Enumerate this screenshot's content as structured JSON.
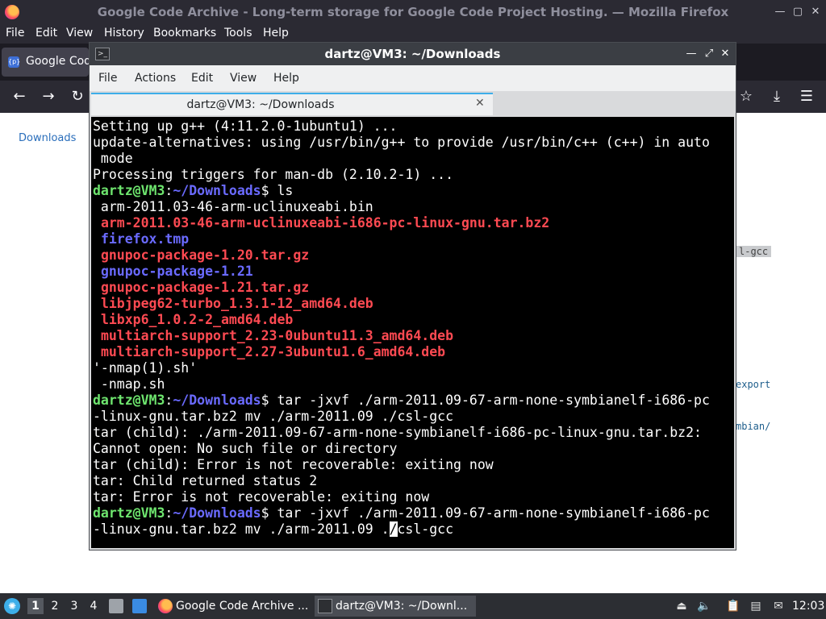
{
  "firefox": {
    "window_title": "Google Code Archive - Long-term storage for Google Code Project Hosting. — Mozilla Firefox",
    "menus": [
      "File",
      "Edit",
      "View",
      "History",
      "Bookmarks",
      "Tools",
      "Help"
    ],
    "tab_label": "Google Code Archive - Long-term storage for Google Code Project Hosting.",
    "tab_favicon_text": "{p}",
    "content": {
      "downloads_link": "Downloads",
      "snippets": [
        "l-gcc",
        "export",
        "mbian/"
      ]
    },
    "icons": [
      "firefox-logo-icon",
      "back-icon",
      "forward-icon",
      "reload-icon",
      "bookmark-star-icon",
      "downloads-icon",
      "menu-icon"
    ]
  },
  "terminal": {
    "window_title": "dartz@VM3: ~/Downloads",
    "menus": [
      "File",
      "Actions",
      "Edit",
      "View",
      "Help"
    ],
    "tab_label": "dartz@VM3: ~/Downloads",
    "colors": {
      "prompt_user": "#6ee56e",
      "prompt_path": "#6a6aff",
      "archive": "#ff4a52",
      "directory": "#6a6aff",
      "background": "#000000",
      "text": "#ffffff"
    },
    "lines": [
      [
        {
          "t": "Setting up g++ (4:11.2.0-1ubuntu1) ...",
          "c": "plain"
        }
      ],
      [
        {
          "t": "update-alternatives: using /usr/bin/g++ to provide /usr/bin/c++ (c++) in auto",
          "c": "plain"
        }
      ],
      [
        {
          "t": " mode",
          "c": "plain"
        }
      ],
      [
        {
          "t": "Processing triggers for man-db (2.10.2-1) ...",
          "c": "plain"
        }
      ],
      [
        {
          "t": "dartz@VM3",
          "c": "green"
        },
        {
          "t": ":",
          "c": "white"
        },
        {
          "t": "~/Downloads",
          "c": "blue"
        },
        {
          "t": "$ ls",
          "c": "white"
        }
      ],
      [
        {
          "t": " arm-2011.03-46-arm-uclinuxeabi.bin",
          "c": "plain"
        }
      ],
      [
        {
          "t": " ",
          "c": "plain"
        },
        {
          "t": "arm-2011.03-46-arm-uclinuxeabi-i686-pc-linux-gnu.tar.bz2",
          "c": "red"
        }
      ],
      [
        {
          "t": " ",
          "c": "plain"
        },
        {
          "t": "firefox.tmp",
          "c": "blue"
        }
      ],
      [
        {
          "t": " ",
          "c": "plain"
        },
        {
          "t": "gnupoc-package-1.20.tar.gz",
          "c": "red"
        }
      ],
      [
        {
          "t": " ",
          "c": "plain"
        },
        {
          "t": "gnupoc-package-1.21",
          "c": "blue"
        }
      ],
      [
        {
          "t": " ",
          "c": "plain"
        },
        {
          "t": "gnupoc-package-1.21.tar.gz",
          "c": "red"
        }
      ],
      [
        {
          "t": " ",
          "c": "plain"
        },
        {
          "t": "libjpeg62-turbo_1.3.1-12_amd64.deb",
          "c": "red"
        }
      ],
      [
        {
          "t": " ",
          "c": "plain"
        },
        {
          "t": "libxp6_1.0.2-2_amd64.deb",
          "c": "red"
        }
      ],
      [
        {
          "t": " ",
          "c": "plain"
        },
        {
          "t": "multiarch-support_2.23-0ubuntu11.3_amd64.deb",
          "c": "red"
        }
      ],
      [
        {
          "t": " ",
          "c": "plain"
        },
        {
          "t": "multiarch-support_2.27-3ubuntu1.6_amd64.deb",
          "c": "red"
        }
      ],
      [
        {
          "t": "'-nmap(1).sh'",
          "c": "plain"
        }
      ],
      [
        {
          "t": " -nmap.sh",
          "c": "plain"
        }
      ],
      [
        {
          "t": "dartz@VM3",
          "c": "green"
        },
        {
          "t": ":",
          "c": "white"
        },
        {
          "t": "~/Downloads",
          "c": "blue"
        },
        {
          "t": "$ tar -jxvf ./arm-2011.09-67-arm-none-symbianelf-i686-pc",
          "c": "white"
        }
      ],
      [
        {
          "t": "-linux-gnu.tar.bz2 mv ./arm-2011.09 ./csl-gcc",
          "c": "plain"
        }
      ],
      [
        {
          "t": "tar (child): ./arm-2011.09-67-arm-none-symbianelf-i686-pc-linux-gnu.tar.bz2:",
          "c": "plain"
        }
      ],
      [
        {
          "t": "Cannot open: No such file or directory",
          "c": "plain"
        }
      ],
      [
        {
          "t": "tar (child): Error is not recoverable: exiting now",
          "c": "plain"
        }
      ],
      [
        {
          "t": "tar: Child returned status 2",
          "c": "plain"
        }
      ],
      [
        {
          "t": "tar: Error is not recoverable: exiting now",
          "c": "plain"
        }
      ],
      [
        {
          "t": "dartz@VM3",
          "c": "green"
        },
        {
          "t": ":",
          "c": "white"
        },
        {
          "t": "~/Downloads",
          "c": "blue"
        },
        {
          "t": "$ tar -jxvf ./arm-2011.09-67-arm-none-symbianelf-i686-pc",
          "c": "white"
        }
      ],
      [
        {
          "t": "-linux-gnu.tar.bz2 mv ./arm-2011.09 .",
          "c": "plain"
        },
        {
          "t": "/",
          "c": "cursor"
        },
        {
          "t": "csl-gcc",
          "c": "plain"
        }
      ]
    ]
  },
  "taskbar": {
    "workspaces": [
      "1",
      "2",
      "3",
      "4"
    ],
    "tasks": [
      {
        "label": "Google Code Archive ...",
        "icon": "firefox-icon"
      },
      {
        "label": "dartz@VM3: ~/Downl...",
        "icon": "terminal-icon"
      }
    ],
    "tray_icons": [
      "eject-icon",
      "volume-icon",
      "clipboard-icon",
      "network-icon",
      "notification-icon"
    ],
    "clock": "12:03"
  }
}
